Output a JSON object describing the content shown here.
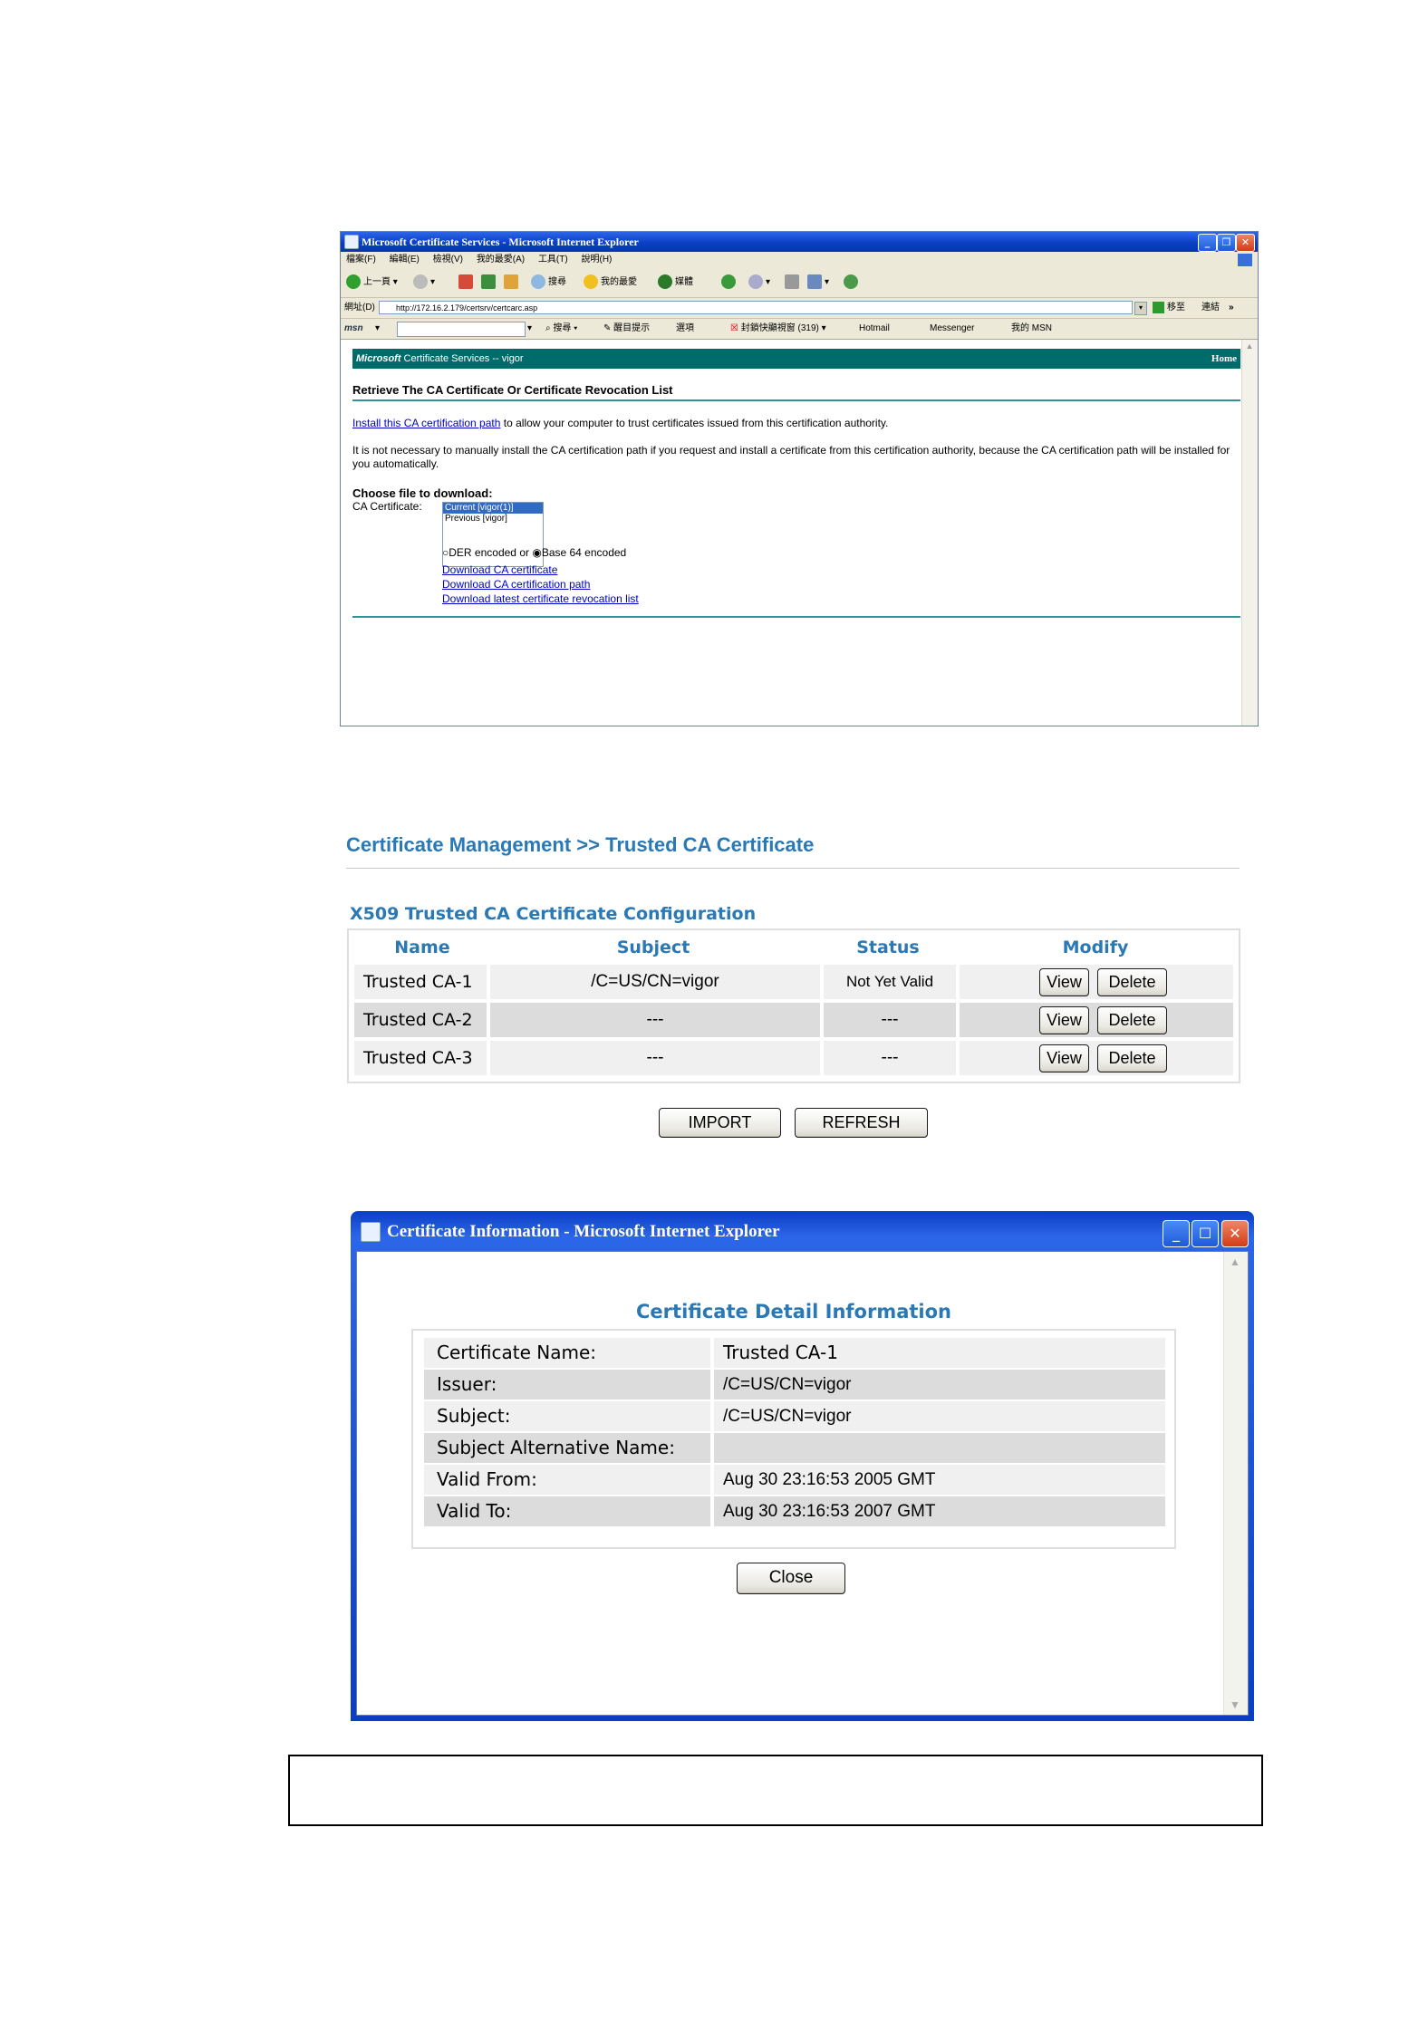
{
  "ie1": {
    "title": "Microsoft Certificate Services - Microsoft Internet Explorer",
    "menu": [
      "檔案(F)",
      "編輯(E)",
      "檢視(V)",
      "我的最愛(A)",
      "工具(T)",
      "說明(H)"
    ],
    "toolbar": {
      "back": "上一頁",
      "search": "搜尋",
      "favorites": "我的最愛",
      "media": "媒體"
    },
    "address_label": "網址(D)",
    "address_value": "http://172.16.2.179/certsrv/certcarc.asp",
    "go_label": "移至",
    "links_label": "連結",
    "msn_search": "搜尋",
    "msn_highlight": "醒目提示",
    "msn_options": "選項",
    "msn_popup": "封鎖快顯視窗 (319)",
    "msn_hotmail": "Hotmail",
    "msn_messenger": "Messenger",
    "msn_my": "我的 MSN",
    "page": {
      "banner_brand": "Microsoft",
      "banner_text": " Certificate Services  --  vigor",
      "home": "Home",
      "heading": "Retrieve The CA Certificate Or Certificate Revocation List",
      "install_link": "Install this CA certification path",
      "install_rest": " to allow your computer to trust certificates issued from this certification authority.",
      "para2": "It is not necessary to manually install the CA certification path if you request and install a certificate from this certification authority, because the CA certification path will be installed for you automatically.",
      "choose_label": "Choose file to download:",
      "ca_cert_label": "CA Certificate:",
      "options": [
        "Current [vigor(1)]",
        "Previous [vigor]"
      ],
      "der_label": "DER encoded",
      "or_label": "or",
      "b64_label": "Base 64 encoded",
      "link_ca": "Download CA certificate",
      "link_path": "Download CA certification path",
      "link_crl": "Download latest certificate revocation list"
    }
  },
  "ca": {
    "title": "Certificate Management >> Trusted CA Certificate",
    "subtitle": "X509 Trusted CA Certificate Configuration",
    "headers": [
      "Name",
      "Subject",
      "Status",
      "Modify"
    ],
    "rows": [
      {
        "name": "Trusted CA-1",
        "subject": "/C=US/CN=vigor",
        "status": "Not Yet Valid",
        "view": "View",
        "delete": "Delete"
      },
      {
        "name": "Trusted CA-2",
        "subject": "---",
        "status": "---",
        "view": "View",
        "delete": "Delete"
      },
      {
        "name": "Trusted CA-3",
        "subject": "---",
        "status": "---",
        "view": "View",
        "delete": "Delete"
      }
    ],
    "import_label": "IMPORT",
    "refresh_label": "REFRESH"
  },
  "popup": {
    "title": "Certificate Information - Microsoft Internet Explorer",
    "heading": "Certificate Detail Information",
    "rows": [
      {
        "label": "Certificate Name:",
        "value": "Trusted CA-1"
      },
      {
        "label": "Issuer:",
        "value": "/C=US/CN=vigor"
      },
      {
        "label": "Subject:",
        "value": "/C=US/CN=vigor"
      },
      {
        "label": "Subject Alternative Name:",
        "value": ""
      },
      {
        "label": "Valid From:",
        "value": "Aug 30 23:16:53 2005 GMT"
      },
      {
        "label": "Valid To:",
        "value": "Aug 30 23:16:53 2007 GMT"
      }
    ],
    "close_label": "Close"
  }
}
